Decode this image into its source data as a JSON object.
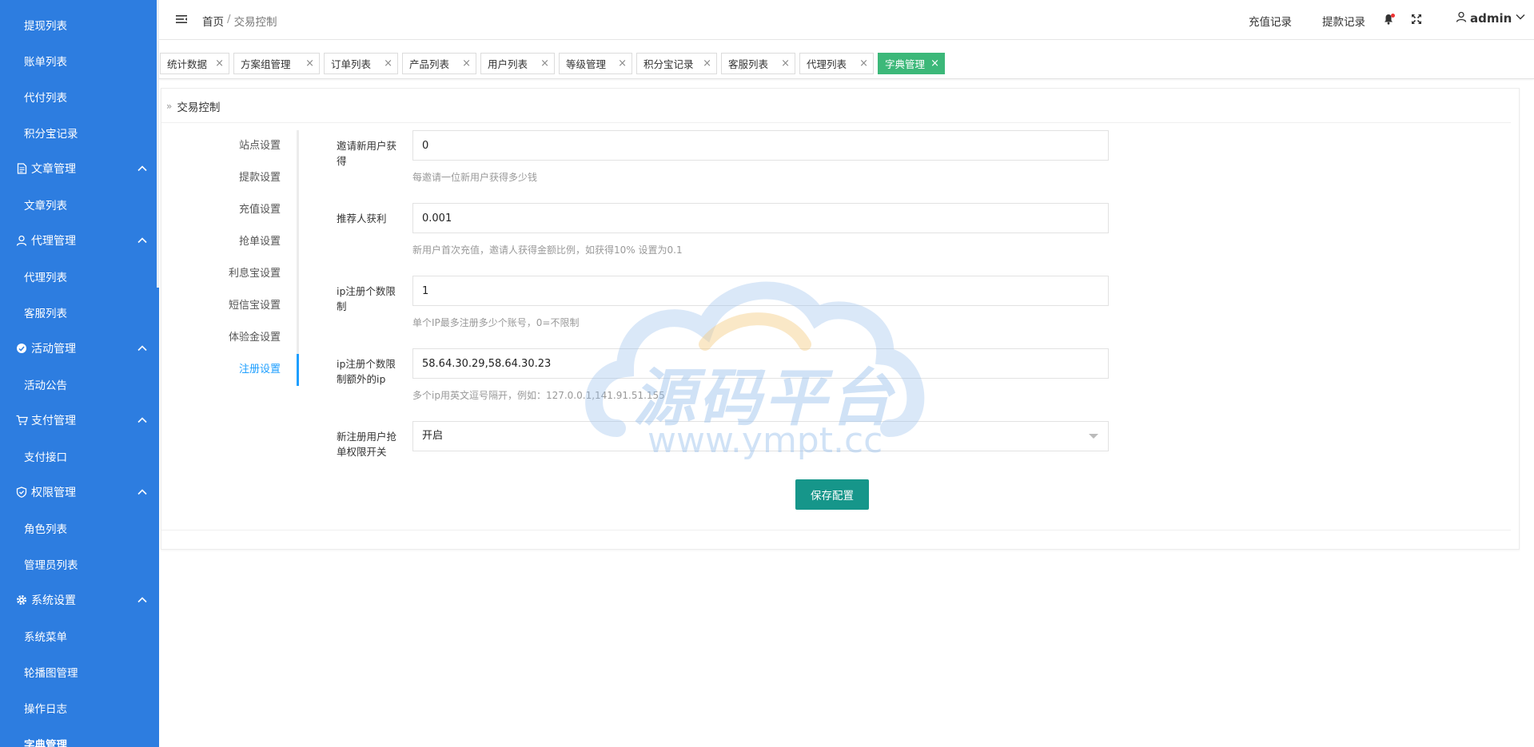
{
  "sidebar": {
    "items": [
      {
        "type": "sub",
        "label": "提现列表"
      },
      {
        "type": "sub",
        "label": "账单列表"
      },
      {
        "type": "sub",
        "label": "代付列表"
      },
      {
        "type": "sub",
        "label": "积分宝记录"
      },
      {
        "type": "group",
        "label": "文章管理",
        "icon": "document-icon"
      },
      {
        "type": "sub",
        "label": "文章列表"
      },
      {
        "type": "group",
        "label": "代理管理",
        "icon": "user-icon"
      },
      {
        "type": "sub",
        "label": "代理列表"
      },
      {
        "type": "sub",
        "label": "客服列表"
      },
      {
        "type": "group",
        "label": "活动管理",
        "icon": "activity-icon"
      },
      {
        "type": "sub",
        "label": "活动公告"
      },
      {
        "type": "group",
        "label": "支付管理",
        "icon": "cart-icon"
      },
      {
        "type": "sub",
        "label": "支付接口"
      },
      {
        "type": "group",
        "label": "权限管理",
        "icon": "shield-icon"
      },
      {
        "type": "sub",
        "label": "角色列表"
      },
      {
        "type": "sub",
        "label": "管理员列表"
      },
      {
        "type": "group",
        "label": "系统设置",
        "icon": "gear-icon"
      },
      {
        "type": "sub",
        "label": "系统菜单"
      },
      {
        "type": "sub",
        "label": "轮播图管理"
      },
      {
        "type": "sub",
        "label": "操作日志"
      },
      {
        "type": "sub",
        "label": "字典管理",
        "active": true
      }
    ]
  },
  "header": {
    "breadcrumb_home": "首页",
    "breadcrumb_sep": "/",
    "breadcrumb_current": "交易控制",
    "recharge_link": "充值记录",
    "withdraw_link": "提款记录",
    "user_name": "admin"
  },
  "tabs": [
    {
      "label": "统计数据"
    },
    {
      "label": "方案组管理"
    },
    {
      "label": "订单列表"
    },
    {
      "label": "产品列表"
    },
    {
      "label": "用户列表"
    },
    {
      "label": "等级管理"
    },
    {
      "label": "积分宝记录"
    },
    {
      "label": "客服列表"
    },
    {
      "label": "代理列表"
    },
    {
      "label": "字典管理",
      "active": true
    }
  ],
  "card": {
    "title": "交易控制"
  },
  "settings_nav": [
    {
      "label": "站点设置"
    },
    {
      "label": "提款设置"
    },
    {
      "label": "充值设置"
    },
    {
      "label": "抢单设置"
    },
    {
      "label": "利息宝设置"
    },
    {
      "label": "短信宝设置"
    },
    {
      "label": "体验金设置"
    },
    {
      "label": "注册设置",
      "active": true
    }
  ],
  "form": {
    "invite_reward": {
      "label": "邀请新用户获得",
      "value": "0",
      "hint": "每邀请一位新用户获得多少钱"
    },
    "referrer_profit": {
      "label": "推荐人获利",
      "value": "0.001",
      "hint": "新用户首次充值，邀请人获得金额比例，如获得10% 设置为0.1"
    },
    "ip_limit": {
      "label": "ip注册个数限制",
      "value": "1",
      "hint": "单个IP最多注册多少个账号，0=不限制"
    },
    "ip_exempt": {
      "label": "ip注册个数限制额外的ip",
      "value": "58.64.30.29,58.64.30.23",
      "hint": "多个ip用英文逗号隔开，例如：127.0.0.1,141.91.51.155"
    },
    "grab_switch": {
      "label": "新注册用户抢单权限开关",
      "value": "开启"
    },
    "save_label": "保存配置"
  },
  "watermark": {
    "text": "源码平台",
    "url": "www.ympt.cc"
  }
}
